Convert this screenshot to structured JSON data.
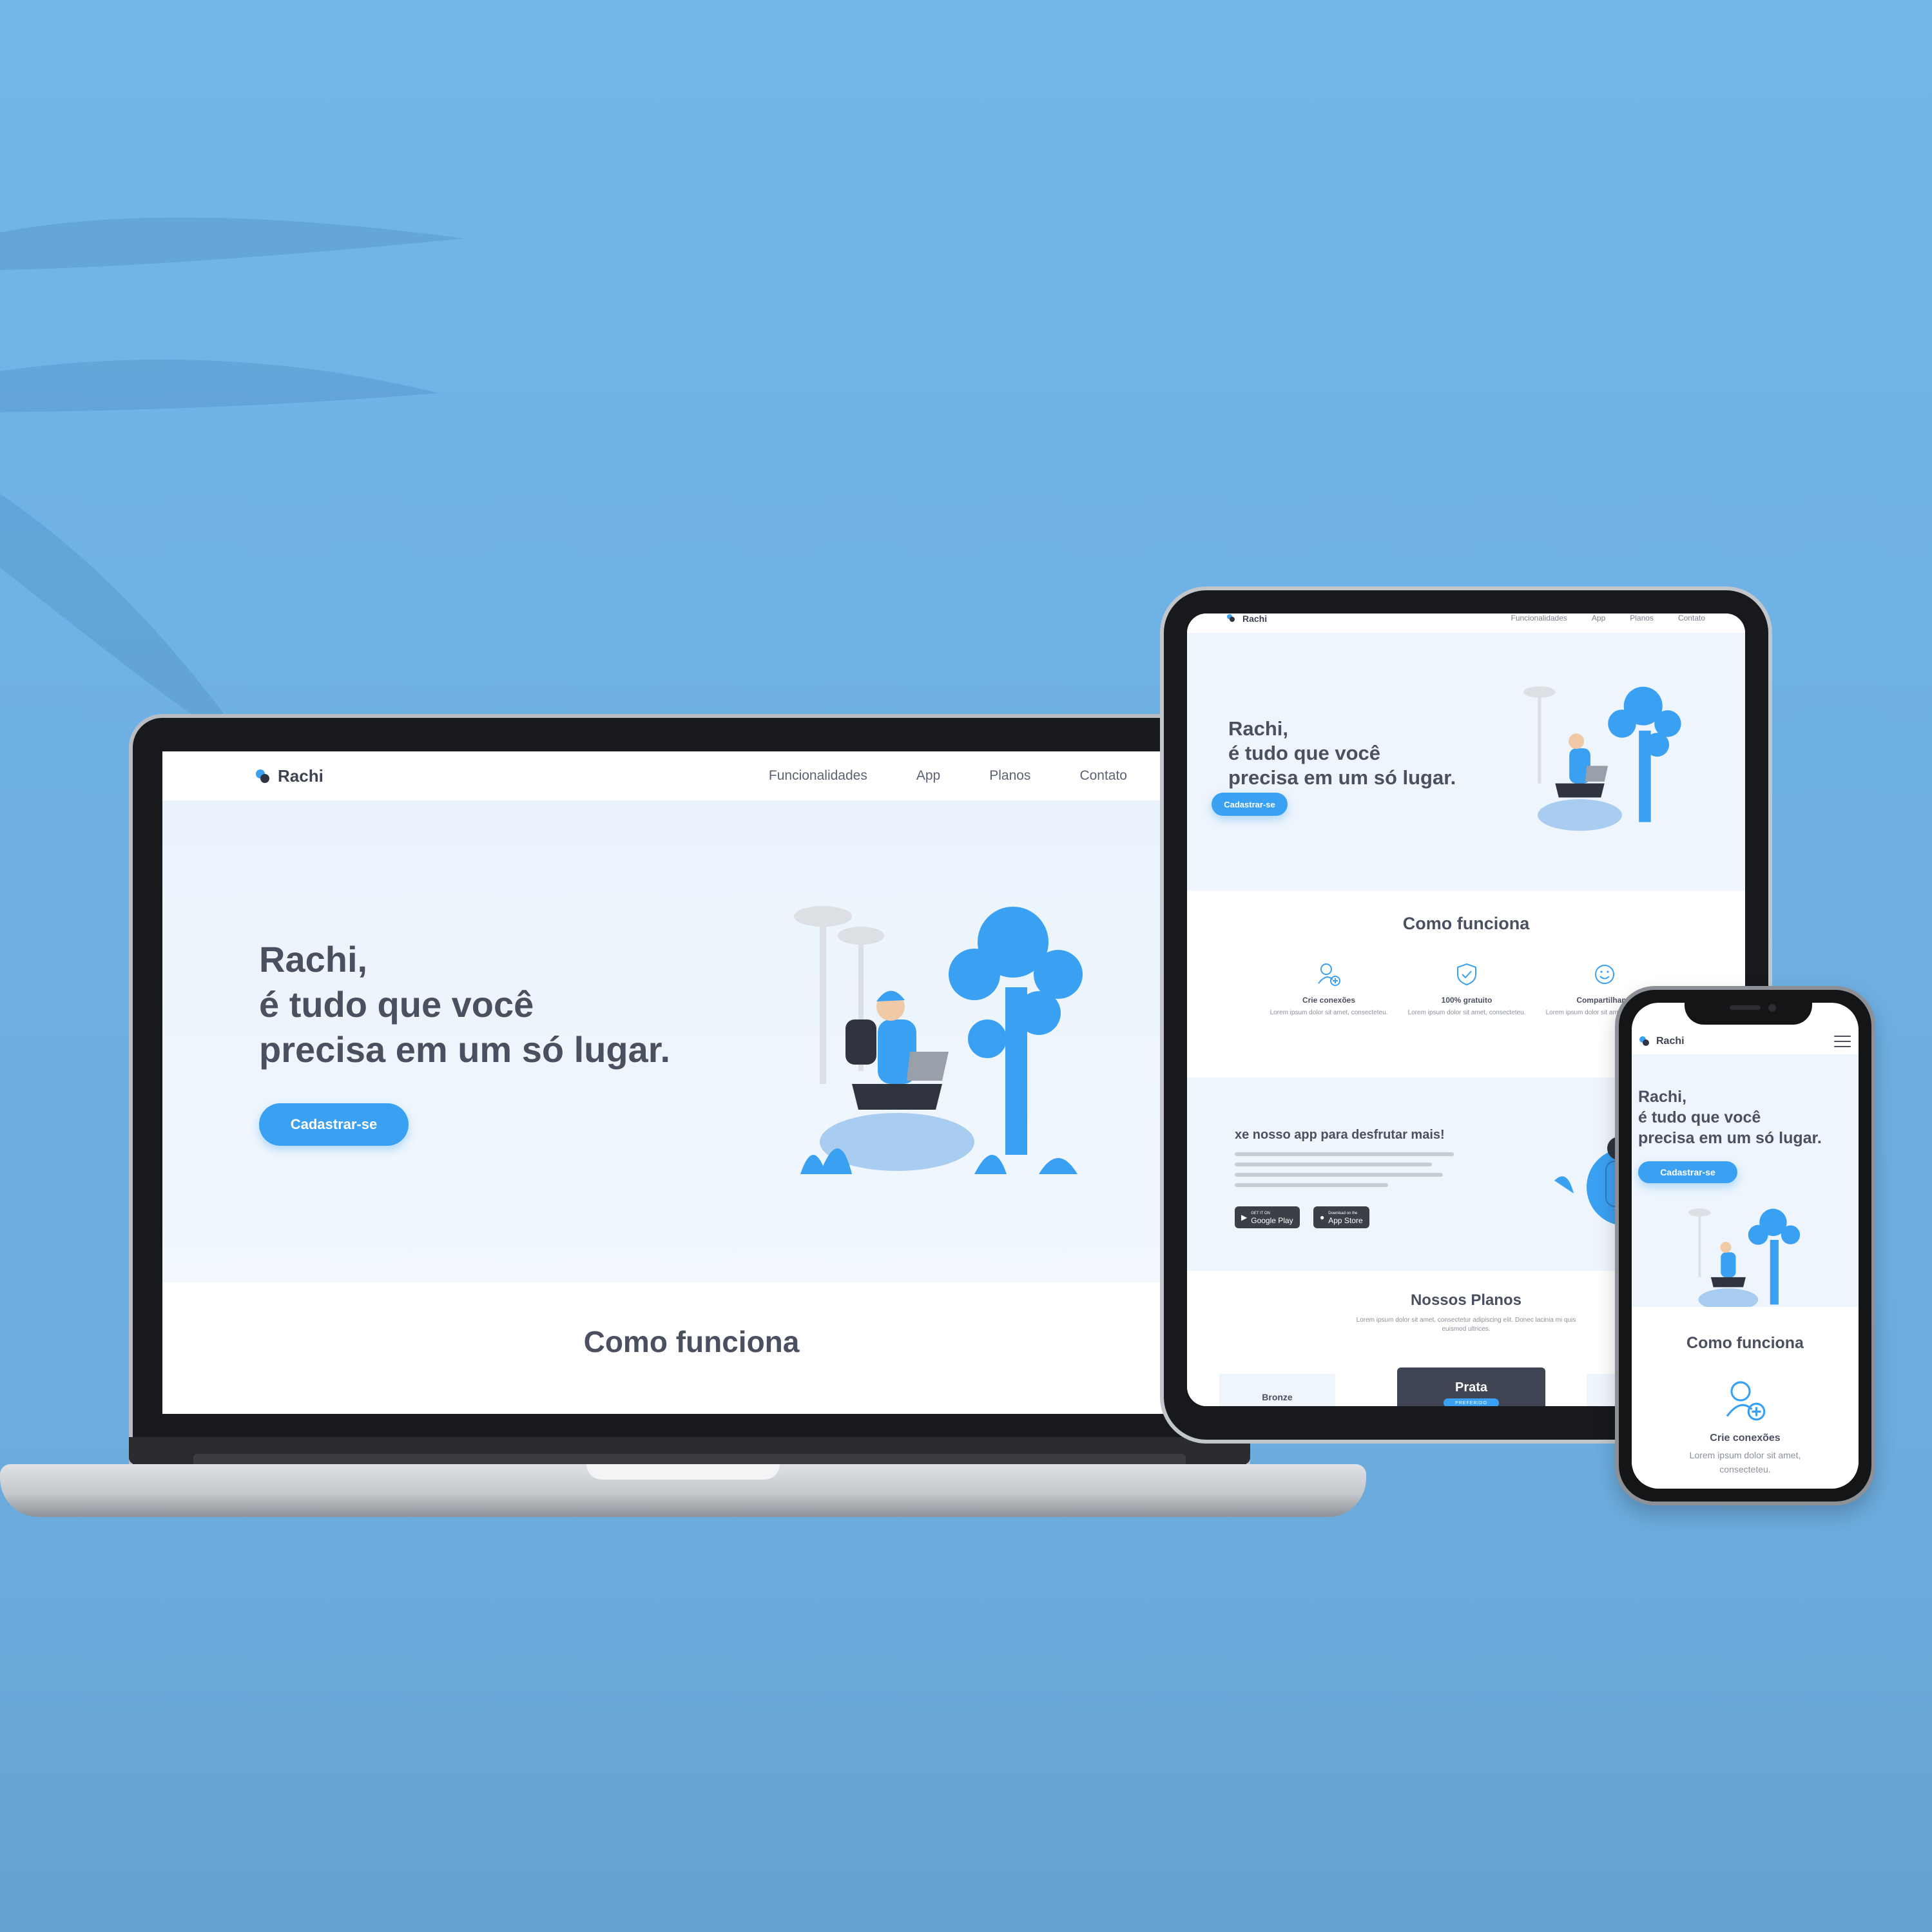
{
  "brand": {
    "name": "Rachi",
    "primary_color": "#3aa0f2",
    "text_color": "#4a5060",
    "background_color": "#72b6ea"
  },
  "nav": {
    "items": [
      "Funcionalidades",
      "App",
      "Planos",
      "Contato"
    ]
  },
  "hero": {
    "line1": "Rachi,",
    "line2": "é tudo que você",
    "line3": "precisa em um só lugar.",
    "cta": "Cadastrar-se"
  },
  "como_funciona": {
    "title": "Como funciona",
    "features": [
      {
        "title": "Crie conexões",
        "desc": "Lorem ipsum dolor sit amet, consecteteu.",
        "icon": "add-user-icon"
      },
      {
        "title": "100% gratuito",
        "desc": "Lorem ipsum dolor sit amet, consecteteu.",
        "icon": "shield-check-icon"
      },
      {
        "title": "Compartilhame",
        "desc": "Lorem ipsum dolor sit amet, consecteteu.",
        "icon": "smile-icon"
      }
    ]
  },
  "app_section": {
    "title": "xe nosso app para desfrutar mais!",
    "google_play": {
      "small": "GET IT ON",
      "label": "Google Play"
    },
    "app_store": {
      "small": "Download on the",
      "label": "App Store"
    }
  },
  "planos": {
    "title": "Nossos Planos",
    "subtitle": "Lorem ipsum dolor sit amet, consectetur adipiscing elit. Donec lacinia mi quis euismod ultrices.",
    "items": [
      "Bronze",
      "Prata"
    ],
    "badge": "PREFERIDO"
  }
}
